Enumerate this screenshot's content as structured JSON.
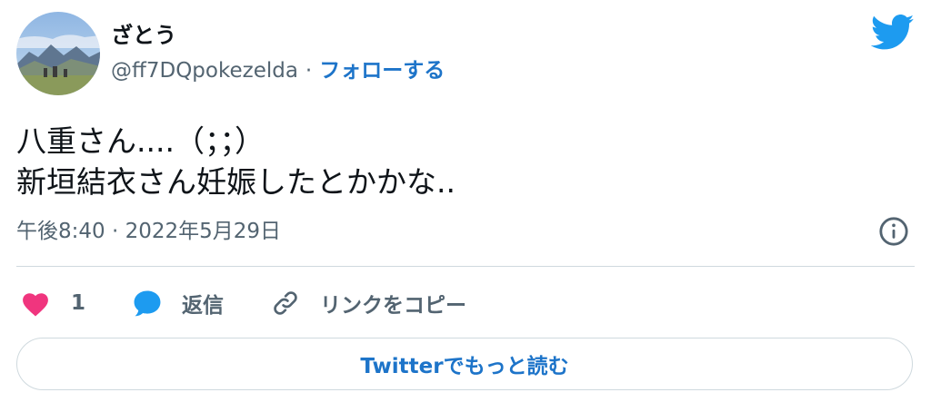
{
  "author": {
    "display_name": "ざとう",
    "handle": "@ff7DQpokezelda",
    "separator": "·",
    "follow_label": "フォローする"
  },
  "tweet": {
    "lines": [
      "八重さん....（；；）",
      "新垣結衣さん妊娠したとかかな.."
    ],
    "timestamp": "午後8:40 · 2022年5月29日"
  },
  "actions": {
    "like_count": "1",
    "reply_label": "返信",
    "copy_link_label": "リンクをコピー"
  },
  "read_more_label": "Twitterでもっと読む",
  "colors": {
    "link_blue": "#1d74c9",
    "twitter_bird": "#1d9bf0",
    "like_pink": "#f0357e",
    "reply_blue": "#1d9bf0",
    "muted_text": "#536471",
    "divider": "#cfd9de"
  },
  "icons": [
    "twitter-bird-icon",
    "info-icon",
    "heart-icon",
    "reply-bubble-icon",
    "link-icon"
  ]
}
